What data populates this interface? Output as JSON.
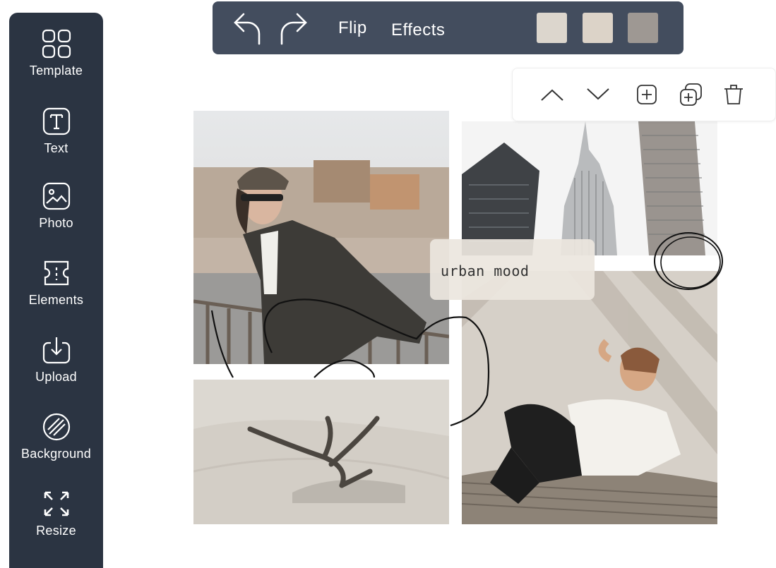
{
  "sidebar": {
    "items": [
      {
        "label": "Template",
        "icon": "grid-icon"
      },
      {
        "label": "Text",
        "icon": "text-icon"
      },
      {
        "label": "Photo",
        "icon": "image-icon"
      },
      {
        "label": "Elements",
        "icon": "ticket-icon"
      },
      {
        "label": "Upload",
        "icon": "upload-icon"
      },
      {
        "label": "Background",
        "icon": "stripes-icon"
      },
      {
        "label": "Resize",
        "icon": "resize-icon"
      }
    ]
  },
  "toolbar": {
    "undo_icon": "undo-icon",
    "redo_icon": "redo-icon",
    "flip_label": "Flip",
    "effects_label": "Effects",
    "swatches": [
      "#dcd6cd",
      "#dcd3c8",
      "#9e9893"
    ]
  },
  "layer_panel": {
    "icons": [
      "chevron-up-icon",
      "chevron-down-icon",
      "add-icon",
      "duplicate-icon",
      "trash-icon"
    ]
  },
  "canvas": {
    "caption": "urban mood"
  },
  "colors": {
    "sidebar_bg": "#2b3442",
    "toolbar_bg": "#434d5e",
    "canvas_bg": "#ffffff"
  }
}
